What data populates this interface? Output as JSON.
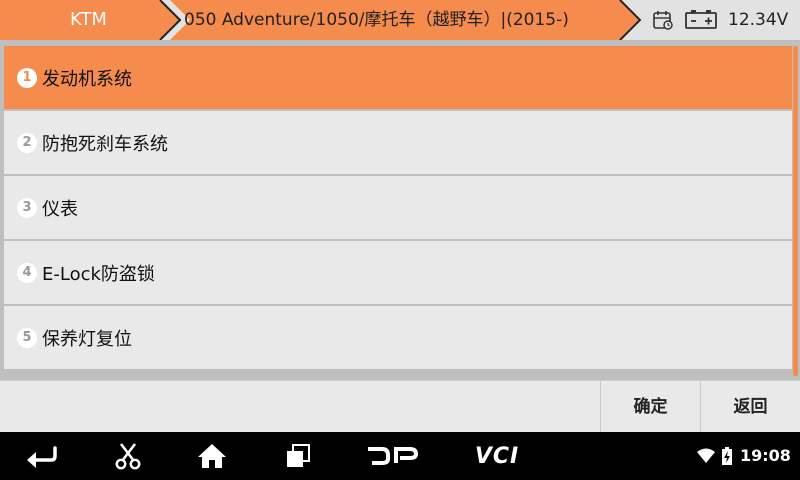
{
  "header": {
    "brand": "KTM",
    "model_path": "050 Adventure/1050/摩托车（越野车）|(2015-)",
    "voltage": "12.34V",
    "brand_color": "#f58b4c"
  },
  "menu": {
    "items": [
      {
        "num": "1",
        "label": "发动机系统",
        "selected": true
      },
      {
        "num": "2",
        "label": "防抱死刹车系统",
        "selected": false
      },
      {
        "num": "3",
        "label": "仪表",
        "selected": false
      },
      {
        "num": "4",
        "label": "E-Lock防盗锁",
        "selected": false
      },
      {
        "num": "5",
        "label": "保养灯复位",
        "selected": false
      }
    ]
  },
  "actions": {
    "ok_label": "确定",
    "back_label": "返回"
  },
  "navbar": {
    "icons": [
      "back-arrow-icon",
      "scissors-icon",
      "home-icon",
      "recent-apps-icon",
      "dp-logo-icon",
      "vci-logo-icon"
    ],
    "vci_label": "VCI",
    "time": "19:08"
  }
}
